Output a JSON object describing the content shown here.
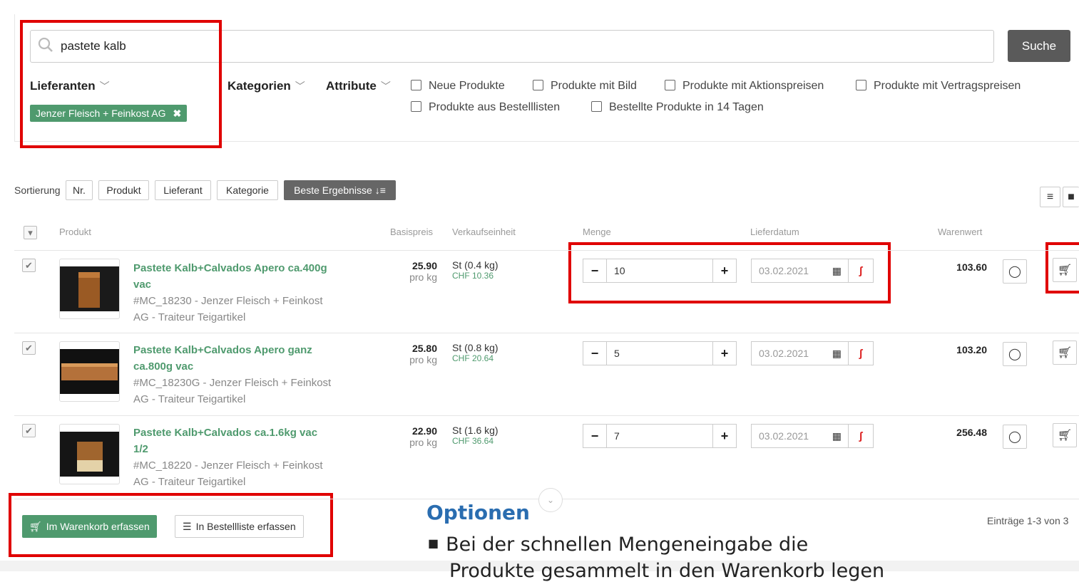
{
  "search": {
    "value": "pastete kalb",
    "button": "Suche"
  },
  "filters": {
    "lieferanten": "Lieferanten",
    "kategorien": "Kategorien",
    "attribute": "Attribute",
    "selected_tag": "Jenzer Fleisch + Feinkost AG",
    "checkboxes": [
      "Neue Produkte",
      "Produkte mit Bild",
      "Produkte mit Aktionspreisen",
      "Produkte mit Vertragspreisen",
      "Produkte aus Bestelllisten",
      "Bestellte Produkte in 14 Tagen"
    ]
  },
  "sort": {
    "label": "Sortierung",
    "buttons": [
      "Nr.",
      "Produkt",
      "Lieferant",
      "Kategorie",
      "Beste Ergebnisse"
    ]
  },
  "table": {
    "headers": {
      "produkt": "Produkt",
      "basispreis": "Basispreis",
      "verkaufseinheit": "Verkaufseinheit",
      "menge": "Menge",
      "lieferdatum": "Lieferdatum",
      "warenwert": "Warenwert"
    },
    "rows": [
      {
        "name_l1": "Pastete Kalb+Calvados Apero ca.400g",
        "name_l2": "vac",
        "meta_l1": "#MC_18230 - Jenzer Fleisch + Feinkost",
        "meta_l2": "AG - Traiteur Teigartikel",
        "price": "25.90",
        "price_unit": "pro kg",
        "unit": "St (0.4 kg)",
        "unit_chf": "CHF 10.36",
        "qty": "10",
        "date": "03.02.2021",
        "wert": "103.60"
      },
      {
        "name_l1": "Pastete Kalb+Calvados Apero ganz",
        "name_l2": "ca.800g vac",
        "meta_l1": "#MC_18230G - Jenzer Fleisch + Feinkost",
        "meta_l2": "AG - Traiteur Teigartikel",
        "price": "25.80",
        "price_unit": "pro kg",
        "unit": "St (0.8 kg)",
        "unit_chf": "CHF 20.64",
        "qty": "5",
        "date": "03.02.2021",
        "wert": "103.20"
      },
      {
        "name_l1": "Pastete Kalb+Calvados ca.1.6kg vac",
        "name_l2": "1/2",
        "meta_l1": "#MC_18220 - Jenzer Fleisch + Feinkost",
        "meta_l2": "AG - Traiteur Teigartikel",
        "price": "22.90",
        "price_unit": "pro kg",
        "unit": "St (1.6 kg)",
        "unit_chf": "CHF 36.64",
        "qty": "7",
        "date": "03.02.2021",
        "wert": "256.48"
      }
    ]
  },
  "footer": {
    "cart_button": "Im Warenkorb erfassen",
    "list_button": "In Bestellliste erfassen",
    "entries": "Einträge 1-3 von 3"
  },
  "options": {
    "title": "Optionen",
    "item_l1": "Bei der schnellen Mengeneingabe die",
    "item_l2": "Produkte gesammelt in den Warenkorb legen"
  },
  "colors": {
    "accent_green": "#4f9a6e",
    "highlight_red": "#e00000",
    "options_blue": "#2a6db0"
  }
}
